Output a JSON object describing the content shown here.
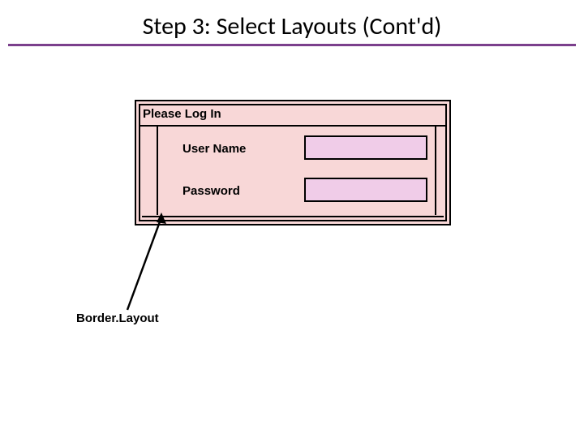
{
  "title": "Step 3: Select Layouts (Cont'd)",
  "panel": {
    "heading": "Please Log In",
    "fields": {
      "username_label": "User Name",
      "password_label": "Password"
    }
  },
  "annotation": "Border.Layout"
}
